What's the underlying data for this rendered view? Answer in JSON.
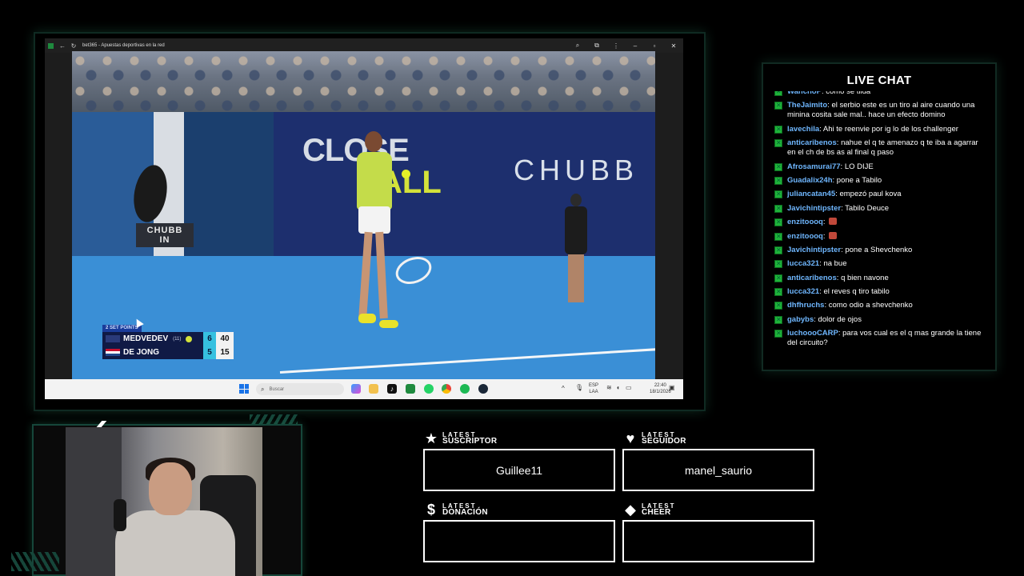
{
  "browser": {
    "tab_title": "bet365 - Apuestas deportivas en la red"
  },
  "video": {
    "ad_close": "CLOSE",
    "ad_ball": "ALL",
    "ad_chubb": "CHUBB",
    "sign_top": "CHUBB",
    "sign_bottom": "IN",
    "scoreboard": {
      "tag": "2 SET POINTS",
      "player1": {
        "name": "MEDVEDEV",
        "seed": "(11)",
        "sets": "6",
        "points": "40"
      },
      "player2": {
        "name": "DE JONG",
        "sets": "5",
        "points": "15"
      }
    }
  },
  "taskbar": {
    "search_placeholder": "Buscar",
    "lang_top": "ESP",
    "lang_bottom": "LAA",
    "time": "22:40",
    "date": "18/1/2026"
  },
  "chat": {
    "title": "LIVE CHAT",
    "messages": [
      {
        "user": "WanchoP",
        "text": "como se tilda"
      },
      {
        "user": "TheJaimito",
        "text": "el serbio este es un tiro al aire cuando una minina cosita sale mal.. hace un efecto domino"
      },
      {
        "user": "lavechila",
        "text": "Ahi te reenvie por ig lo de los challenger"
      },
      {
        "user": "anticaribenos",
        "text": "nahue el q te amenazo q te iba a agarrar en el ch de bs as al final q paso"
      },
      {
        "user": "Afrosamurai77",
        "text": "LO DIJE"
      },
      {
        "user": "Guadalix24h",
        "text": "pone a Tabilo"
      },
      {
        "user": "juliancatan45",
        "text": "empezó paul kova"
      },
      {
        "user": "Javichintipster",
        "text": "Tabilo Deuce"
      },
      {
        "user": "enzitoooq",
        "text": ""
      },
      {
        "user": "enzitoooq",
        "text": ""
      },
      {
        "user": "Javichintipster",
        "text": "pone a Shevchenko"
      },
      {
        "user": "lucca321",
        "text": "na bue"
      },
      {
        "user": "anticaribenos",
        "text": "q bien navone"
      },
      {
        "user": "lucca321",
        "text": "el reves q tiro tabilo"
      },
      {
        "user": "dhfhruchs",
        "text": "como odio a shevchenko"
      },
      {
        "user": "gabybs",
        "text": "dolor de ojos"
      },
      {
        "user": "luchoooCARP",
        "text": "para vos cual es el q mas grande la tiene del circuito?"
      }
    ]
  },
  "latest": {
    "suscriptor": {
      "small": "LATEST",
      "big": "SUSCRIPTOR",
      "value": "Guillee11",
      "icon": "star-icon"
    },
    "seguidor": {
      "small": "LATEST",
      "big": "SEGUIDOR",
      "value": "manel_saurio",
      "icon": "heart-icon"
    },
    "donacion": {
      "small": "LATEST",
      "big": "DONACIÓN",
      "value": "",
      "icon": "dollar-icon"
    },
    "cheer": {
      "small": "LATEST",
      "big": "CHEER",
      "value": "",
      "icon": "diamond-icon"
    }
  }
}
